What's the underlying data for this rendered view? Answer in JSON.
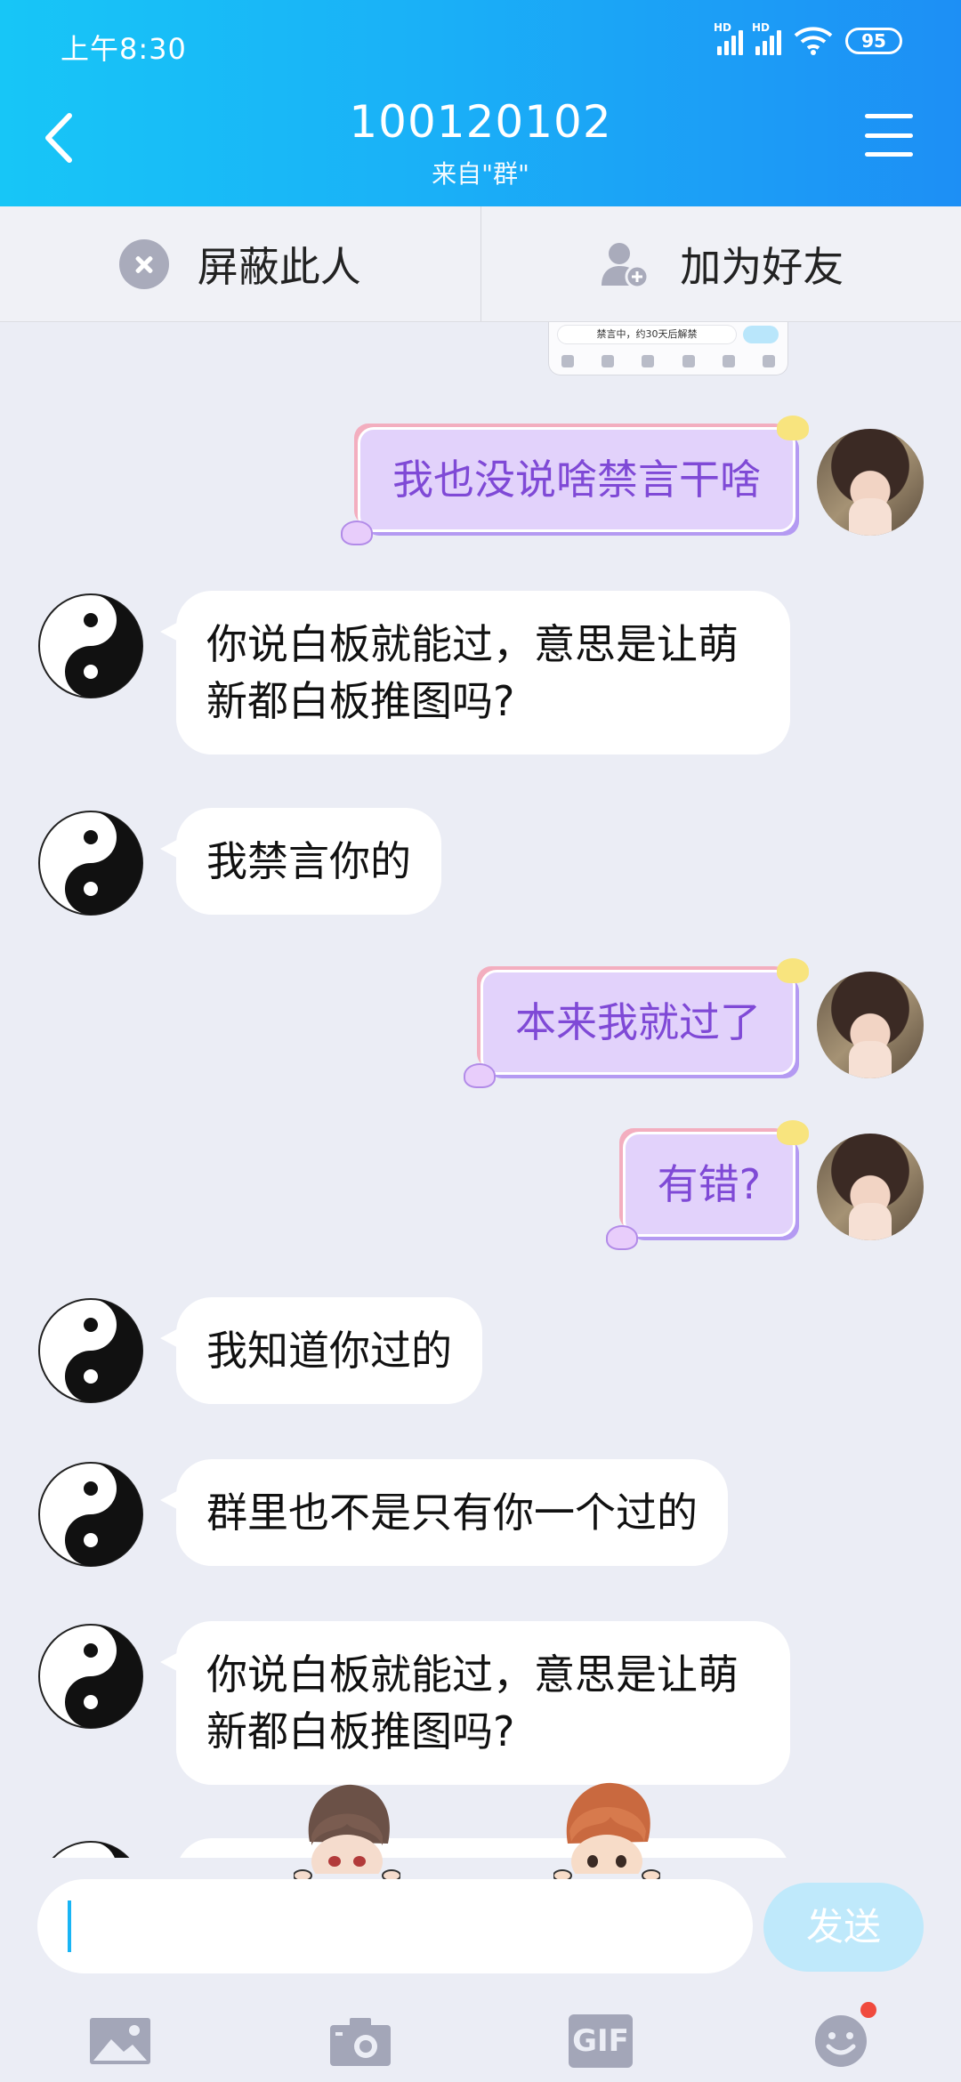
{
  "status_bar": {
    "time": "上午8:30",
    "battery": "95",
    "hd1": "HD",
    "hd2": "HD"
  },
  "header": {
    "title": "100120102",
    "subtitle": "来自\"群\""
  },
  "actions": {
    "block": "屏蔽此人",
    "add_friend": "加为好友"
  },
  "preview_text": "禁言中，约30天后解禁",
  "messages": [
    {
      "side": "out",
      "text": "我也没说啥禁言干啥"
    },
    {
      "side": "in",
      "text": "你说白板就能过，意思是让萌新都白板推图吗?"
    },
    {
      "side": "in",
      "text": "我禁言你的"
    },
    {
      "side": "out",
      "text": "本来我就过了"
    },
    {
      "side": "out",
      "text": "有错?"
    },
    {
      "side": "in",
      "text": "我知道你过的"
    },
    {
      "side": "in",
      "text": "群里也不是只有你一个过的"
    },
    {
      "side": "in",
      "text": "你说白板就能过，意思是让萌新都白板推图吗?"
    }
  ],
  "input": {
    "send_label": "发送",
    "value": ""
  },
  "toolbar": {
    "gif_label": "GIF"
  }
}
